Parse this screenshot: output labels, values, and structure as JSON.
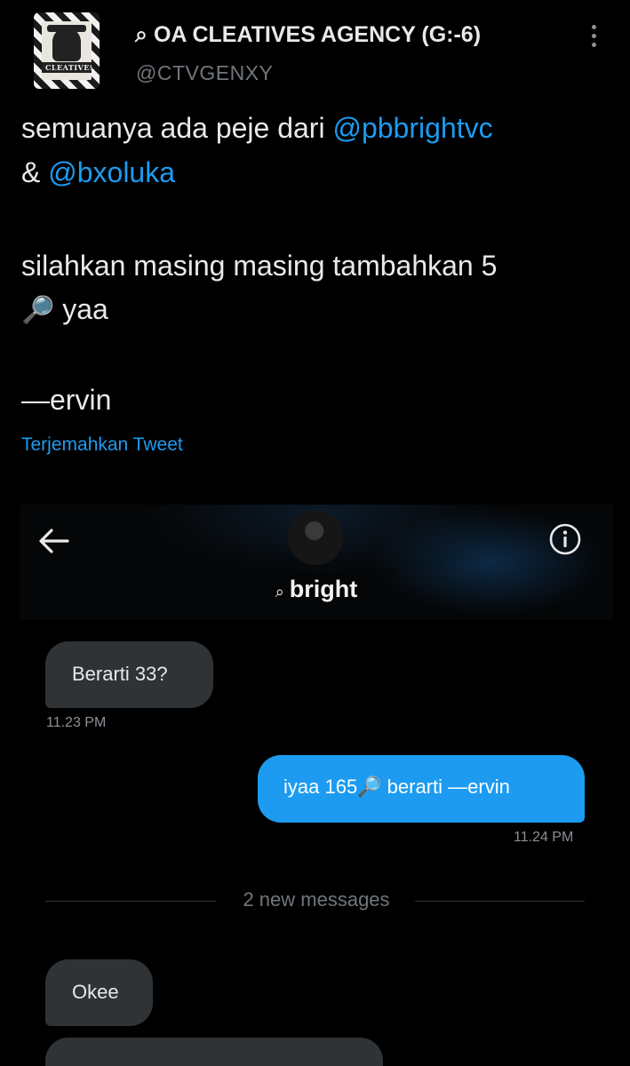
{
  "tweet": {
    "author": {
      "display_name": "⌕ OA CLEATIVES AGENCY (G:-6)",
      "handle": "@CTVGENXY",
      "avatar_text": "CLEATIVES"
    },
    "body": {
      "line1_text": "semuanya ada peje dari ",
      "line1_mention": "@pbbrightvc",
      "line2_text": "& ",
      "line2_mention": "@bxoluka",
      "line3_text": "silahkan masing masing tambahkan 5",
      "line4_emoji": "🔎",
      "line4_text": " yaa",
      "signature": "—ervin"
    },
    "translate_label": "Terjemahkan Tweet",
    "icons": {
      "more": "more-vertical-icon"
    }
  },
  "dm": {
    "contact_prefix": "⌕",
    "contact_name": "bright",
    "icons": {
      "back": "arrow-left-icon",
      "info": "info-circle-icon"
    },
    "messages": [
      {
        "direction": "in",
        "text": "Berarti 33?",
        "time": "11.23 PM"
      },
      {
        "direction": "out",
        "text": "iyaa 165🔎 berarti —ervin",
        "time": "11.24 PM"
      },
      {
        "direction": "in",
        "text": "Okee",
        "time": ""
      }
    ],
    "new_messages_label": "2 new messages"
  },
  "colors": {
    "background": "#000000",
    "mention": "#1d9bf0",
    "outgoing_bubble": "#1d9bf0",
    "incoming_bubble": "#2f3336",
    "secondary_text": "#71767b"
  }
}
